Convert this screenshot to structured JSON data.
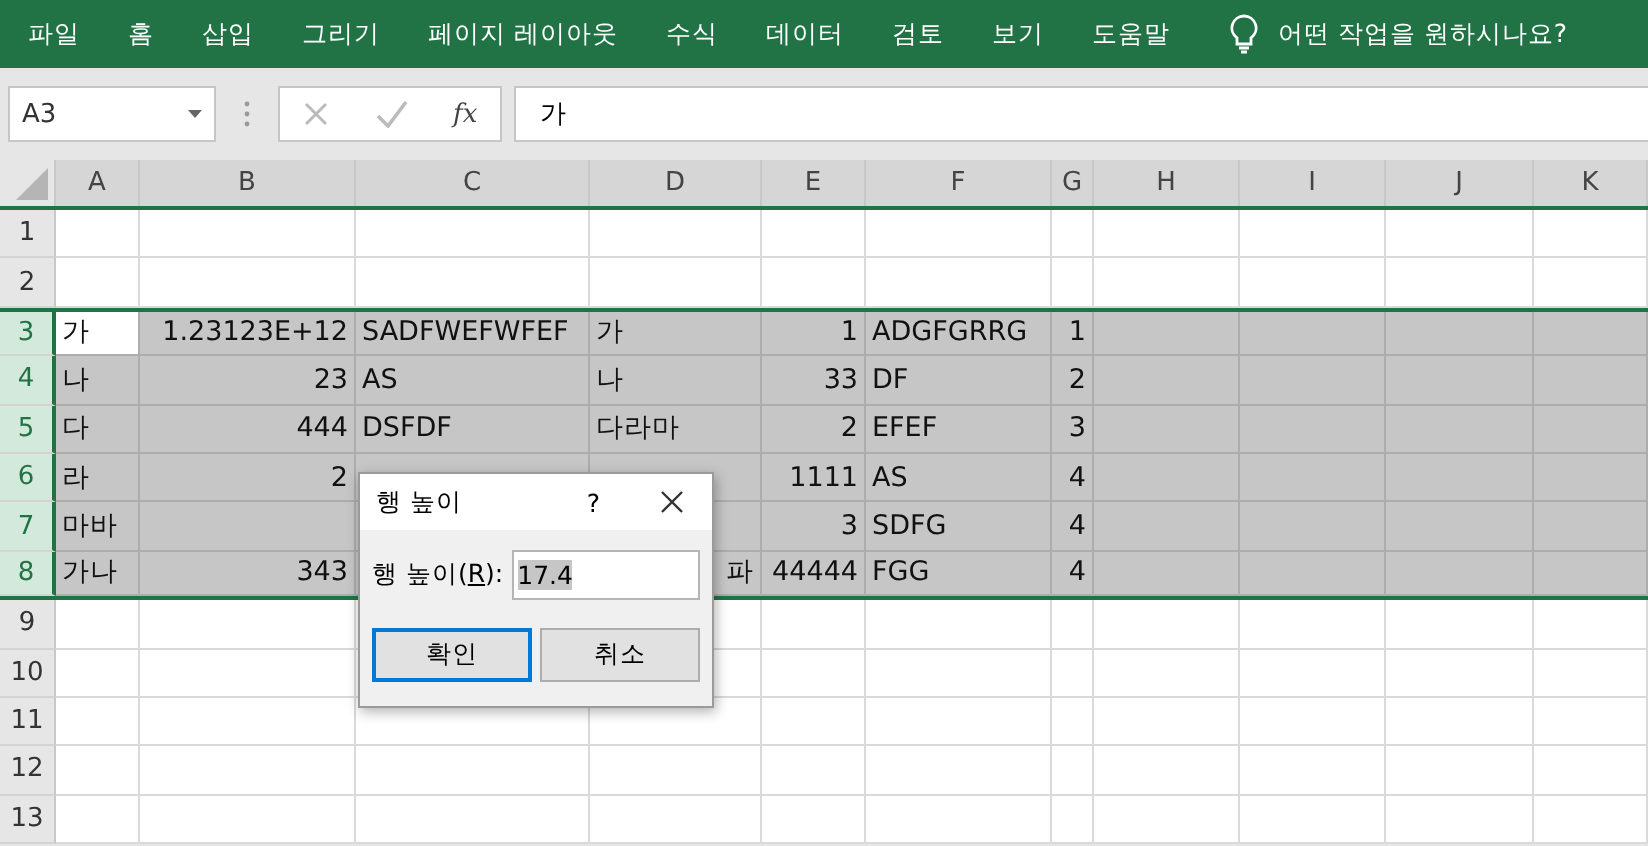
{
  "ribbon": {
    "tabs": [
      {
        "label": "파일"
      },
      {
        "label": "홈"
      },
      {
        "label": "삽입"
      },
      {
        "label": "그리기"
      },
      {
        "label": "페이지 레이아웃"
      },
      {
        "label": "수식"
      },
      {
        "label": "데이터"
      },
      {
        "label": "검토"
      },
      {
        "label": "보기"
      },
      {
        "label": "도움말"
      }
    ],
    "tell_me": "어떤 작업을 원하시나요?"
  },
  "formula_bar": {
    "name_box": "A3",
    "function_label": "fx",
    "value": "가"
  },
  "sheet": {
    "columns": [
      "A",
      "B",
      "C",
      "D",
      "E",
      "F",
      "G",
      "H",
      "I",
      "J",
      "K"
    ],
    "rows": [
      {
        "number": "1",
        "selected": false
      },
      {
        "number": "2",
        "selected": false
      },
      {
        "number": "3",
        "selected": true,
        "cells": [
          {
            "text": "가",
            "kind": "text",
            "active": true
          },
          {
            "text": "1.23123E+12",
            "kind": "number"
          },
          {
            "text": "SADFWEFWFEF",
            "kind": "text"
          },
          {
            "text": "가",
            "kind": "text"
          },
          {
            "text": "1",
            "kind": "number"
          },
          {
            "text": "ADGFGRRG",
            "kind": "text"
          },
          {
            "text": "1",
            "kind": "number"
          }
        ]
      },
      {
        "number": "4",
        "selected": true,
        "cells": [
          {
            "text": "나",
            "kind": "text"
          },
          {
            "text": "23",
            "kind": "number"
          },
          {
            "text": "AS",
            "kind": "text"
          },
          {
            "text": "나",
            "kind": "text"
          },
          {
            "text": "33",
            "kind": "number"
          },
          {
            "text": "DF",
            "kind": "text"
          },
          {
            "text": "2",
            "kind": "number"
          }
        ]
      },
      {
        "number": "5",
        "selected": true,
        "cells": [
          {
            "text": "다",
            "kind": "text"
          },
          {
            "text": "444",
            "kind": "number"
          },
          {
            "text": "DSFDF",
            "kind": "text"
          },
          {
            "text": "다라마",
            "kind": "text"
          },
          {
            "text": "2",
            "kind": "number"
          },
          {
            "text": "EFEF",
            "kind": "text"
          },
          {
            "text": "3",
            "kind": "number"
          }
        ]
      },
      {
        "number": "6",
        "selected": true,
        "cells": [
          {
            "text": "라",
            "kind": "text"
          },
          {
            "text": "2",
            "kind": "number"
          },
          null,
          null,
          {
            "text": "1111",
            "kind": "number"
          },
          {
            "text": "AS",
            "kind": "text"
          },
          {
            "text": "4",
            "kind": "number"
          }
        ]
      },
      {
        "number": "7",
        "selected": true,
        "cells": [
          {
            "text": "마바",
            "kind": "text"
          },
          null,
          null,
          null,
          {
            "text": "3",
            "kind": "number"
          },
          {
            "text": "SDFG",
            "kind": "text"
          },
          {
            "text": "4",
            "kind": "number"
          }
        ]
      },
      {
        "number": "8",
        "selected": true,
        "cells": [
          {
            "text": "가나",
            "kind": "text"
          },
          {
            "text": "343",
            "kind": "number"
          },
          null,
          {
            "text": "파",
            "kind": "number"
          },
          {
            "text": "44444",
            "kind": "number"
          },
          {
            "text": "FGG",
            "kind": "text"
          },
          {
            "text": "4",
            "kind": "number"
          }
        ]
      },
      {
        "number": "9",
        "selected": false
      },
      {
        "number": "10",
        "selected": false
      },
      {
        "number": "11",
        "selected": false
      },
      {
        "number": "12",
        "selected": false
      },
      {
        "number": "13",
        "selected": false
      }
    ]
  },
  "dialog": {
    "title": "행 높이",
    "help": "?",
    "label_before": "행 높이(",
    "access_key": "R",
    "label_after": "):",
    "value": "17.4",
    "value_selected": true,
    "buttons": [
      {
        "label": "확인",
        "default": true
      },
      {
        "label": "취소",
        "default": false
      }
    ]
  }
}
